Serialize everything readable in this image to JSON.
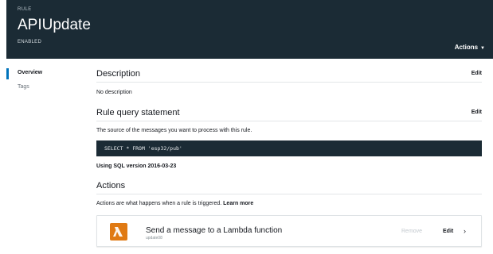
{
  "header": {
    "kicker": "RULE",
    "title": "APIUpdate",
    "status": "ENABLED",
    "actions_label": "Actions"
  },
  "sidebar": {
    "items": [
      {
        "label": "Overview"
      },
      {
        "label": "Tags"
      }
    ]
  },
  "description": {
    "heading": "Description",
    "edit_label": "Edit",
    "text": "No description"
  },
  "query": {
    "heading": "Rule query statement",
    "edit_label": "Edit",
    "intro": "The source of the messages you want to process with this rule.",
    "sql": "SELECT * FROM 'esp32/pub'",
    "sql_version": "Using SQL version 2016-03-23"
  },
  "actions": {
    "heading": "Actions",
    "intro": "Actions are what happens when a rule is triggered.",
    "learn_more": "Learn more",
    "items": [
      {
        "title": "Send a message to a Lambda function",
        "subtitle": "update08",
        "remove_label": "Remove",
        "edit_label": "Edit",
        "icon": "lambda-icon"
      }
    ]
  },
  "colors": {
    "header_bg": "#1b2b35",
    "accent": "#0073bb",
    "lambda_orange": "#e07a13"
  }
}
